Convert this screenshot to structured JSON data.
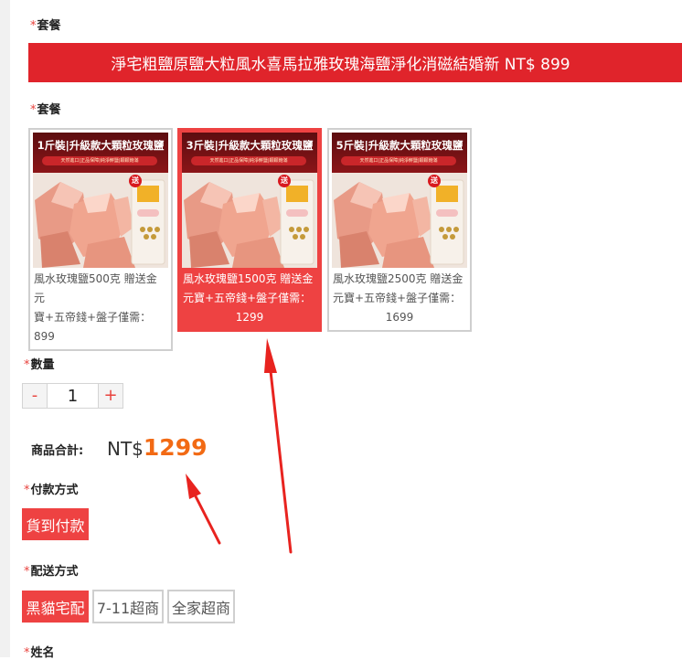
{
  "package_section": {
    "label_1": "套餐",
    "banner": "淨宅粗鹽原鹽大粒風水喜馬拉雅玫瑰海鹽淨化消磁結婚新 NT$ 899",
    "label_2": "套餐",
    "required_mark": "*",
    "options": [
      {
        "thumb_title": "1斤裝|升級款大顆粒玫瑰鹽",
        "thumb_sub": "天然進口|正品保障|純淨鮮鹽|顆顆飽滿",
        "gift": "送",
        "caption_line_1": "風水玫瑰鹽500克 贈送金元",
        "caption_line_2": "寶+五帝錢+盤子僅需：899",
        "caption_line_3": "",
        "selected": false
      },
      {
        "thumb_title": "3斤裝|升級款大顆粒玫瑰鹽",
        "thumb_sub": "天然進口|正品保障|純淨鮮鹽|顆顆飽滿",
        "gift": "送",
        "caption_line_1": "風水玫瑰鹽1500克 贈送金",
        "caption_line_2": "元寶+五帝錢+盤子僅需：",
        "caption_line_3": "1299",
        "selected": true
      },
      {
        "thumb_title": "5斤裝|升級款大顆粒玫瑰鹽",
        "thumb_sub": "天然進口|正品保障|純淨鮮鹽|顆顆飽滿",
        "gift": "送",
        "caption_line_1": "風水玫瑰鹽2500克 贈送金",
        "caption_line_2": "元寶+五帝錢+盤子僅需：",
        "caption_line_3": "1699",
        "selected": false
      }
    ]
  },
  "quantity": {
    "label": "數量",
    "minus": "-",
    "value": "1",
    "plus": "+"
  },
  "total": {
    "label": "商品合計:",
    "currency": "NT$",
    "amount": "1299"
  },
  "payment": {
    "label": "付款方式",
    "options": [
      "貨到付款"
    ],
    "selected": "貨到付款"
  },
  "shipping": {
    "label": "配送方式",
    "options": [
      "黑貓宅配",
      "7-11超商",
      "全家超商"
    ],
    "selected": "黑貓宅配"
  },
  "name_field": {
    "label": "姓名"
  },
  "colors": {
    "accent": "#ee4242",
    "banner": "#e0242b",
    "price": "#f26a14",
    "arrow": "#e8231f"
  }
}
